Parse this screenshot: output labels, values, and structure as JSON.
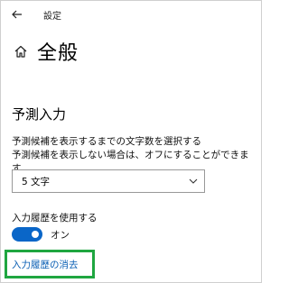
{
  "window": {
    "title": "設定"
  },
  "header": {
    "title": "全般"
  },
  "prediction": {
    "section_title": "予測入力",
    "description_line1": "予測候補を表示するまでの文字数を選択する",
    "description_line2": "予測候補を表示しない場合は、オフにすることができます。",
    "dropdown_value": "5 文字"
  },
  "history": {
    "label": "入力履歴を使用する",
    "toggle_state": "オン",
    "clear_link": "入力履歴の消去"
  },
  "colors": {
    "accent": "#0a66c8",
    "link": "#0a5fb4",
    "highlight": "#1fa640"
  },
  "icons": {
    "back": "back-arrow-icon",
    "home": "home-icon",
    "dropdown": "chevron-down-icon"
  }
}
